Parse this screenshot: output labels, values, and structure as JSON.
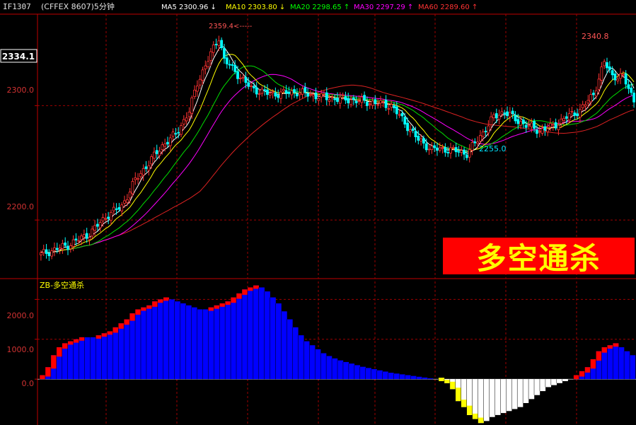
{
  "header": {
    "symbol": "IF1307",
    "exchange": "(CFFEX 8607)5分钟",
    "ma": [
      {
        "label": "MA5 2300.96",
        "arrow": "↓",
        "color": "#ffffff"
      },
      {
        "label": "MA10 2303.80",
        "arrow": "↓",
        "color": "#ffff00"
      },
      {
        "label": "MA20 2298.65",
        "arrow": "↑",
        "color": "#00ff00"
      },
      {
        "label": "MA30 2297.29",
        "arrow": "↑",
        "color": "#ff00ff"
      },
      {
        "label": "MA60  2289.60",
        "arrow": "↑",
        "color": "#ff3333"
      }
    ]
  },
  "price_panel": {
    "current_price": "2334.1",
    "y_ticks": [
      "2300.0",
      "2200.0"
    ],
    "annotation_high": "2359.4<-----",
    "annotation_high_right": "2340.8",
    "annotation_low": "2255.0"
  },
  "indicator_panel": {
    "title": "ZB-多空通杀",
    "y_ticks": [
      "2000.0",
      "1000.0",
      "0.0"
    ]
  },
  "banner_text": "多空通杀",
  "colors": {
    "up": "#ff3232",
    "down": "#00ffff",
    "grid": "#a00000",
    "axis": "#c00000",
    "bar_pos": "#0000ff",
    "bar_pos_edge": "#ff0000",
    "bar_neg": "#ffffff",
    "bar_neg_edge": "#ffff00"
  },
  "chart_data": [
    {
      "type": "candlestick",
      "ylim": [
        2150,
        2380
      ],
      "y_ticks": [
        2200,
        2300
      ],
      "indicators": [
        "MA5",
        "MA10",
        "MA20",
        "MA30",
        "MA60"
      ]
    },
    {
      "type": "bar",
      "ylim": [
        -1150,
        2450
      ],
      "y_ticks": [
        0,
        1000,
        2000
      ],
      "values": [
        100,
        300,
        600,
        800,
        900,
        950,
        1000,
        1050,
        1050,
        1050,
        1100,
        1150,
        1200,
        1300,
        1400,
        1500,
        1650,
        1750,
        1800,
        1850,
        1950,
        2000,
        2050,
        2000,
        1950,
        1900,
        1850,
        1800,
        1750,
        1750,
        1800,
        1850,
        1900,
        1950,
        2050,
        2150,
        2250,
        2300,
        2350,
        2300,
        2200,
        2050,
        1900,
        1700,
        1500,
        1300,
        1100,
        950,
        850,
        750,
        650,
        580,
        520,
        470,
        430,
        390,
        350,
        310,
        280,
        250,
        220,
        190,
        160,
        140,
        120,
        100,
        80,
        60,
        40,
        20,
        0,
        -50,
        -100,
        -250,
        -550,
        -700,
        -900,
        -1000,
        -1100,
        -1050,
        -950,
        -900,
        -850,
        -800,
        -750,
        -700,
        -600,
        -500,
        -400,
        -300,
        -200,
        -150,
        -100,
        -50,
        0,
        100,
        200,
        300,
        500,
        700,
        800,
        850,
        900,
        800,
        700,
        600
      ]
    }
  ]
}
